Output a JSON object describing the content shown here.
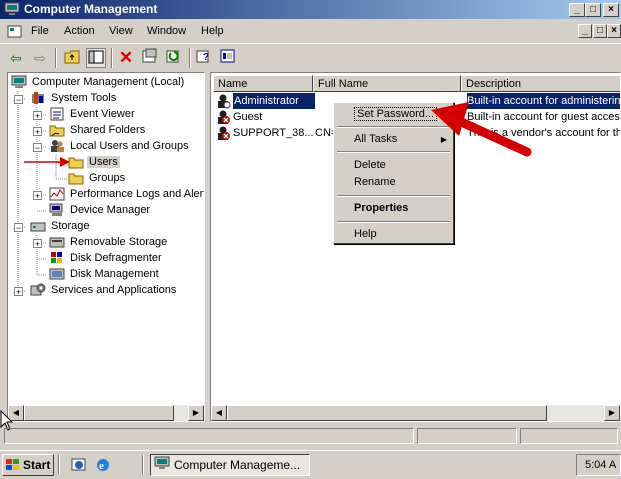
{
  "window": {
    "title": "Computer Management"
  },
  "menu": [
    "File",
    "Action",
    "View",
    "Window",
    "Help"
  ],
  "tree": {
    "items": [
      "Computer Management (Local)",
      "System Tools",
      "Event Viewer",
      "Shared Folders",
      "Local Users and Groups",
      "Users",
      "Groups",
      "Performance Logs and Alerts",
      "Device Manager",
      "Storage",
      "Removable Storage",
      "Disk Defragmenter",
      "Disk Management",
      "Services and Applications"
    ]
  },
  "list": {
    "columns": [
      "Name",
      "Full Name",
      "Description"
    ],
    "rows": [
      {
        "name": "Administrator",
        "full": "",
        "desc": "Built-in account for administering"
      },
      {
        "name": "Guest",
        "full": "",
        "desc": "Built-in account for guest access"
      },
      {
        "name": "SUPPORT_38...",
        "full": "CN=",
        "desc": "This is a vendor's account for the"
      }
    ]
  },
  "context_menu": [
    "Set Password...",
    "All Tasks",
    "Delete",
    "Rename",
    "Properties",
    "Help"
  ],
  "taskbar": {
    "start": "Start",
    "task": "Computer Manageme...",
    "clock": "5:04 A"
  },
  "colors": {
    "accent": "#0a246a",
    "arrow": "#d40000"
  }
}
